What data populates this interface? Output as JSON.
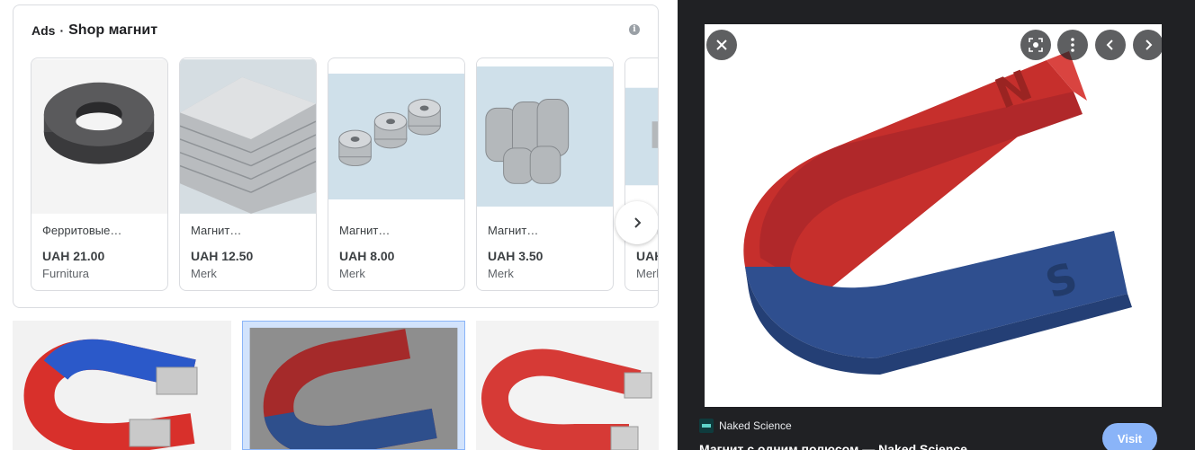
{
  "ads": {
    "label": "Ads",
    "separator": "·",
    "title": "Shop магнит",
    "info_icon": "i"
  },
  "products": [
    {
      "name": "Ферритовые…",
      "price": "UAH 21.00",
      "merchant": "Furnitura",
      "image": "ferrite-ring-magnet"
    },
    {
      "name": "Магнит…",
      "price": "UAH 12.50",
      "merchant": "Merk",
      "image": "block-magnets-stack"
    },
    {
      "name": "Магнит…",
      "price": "UAH 8.00",
      "merchant": "Merk",
      "image": "countersunk-ring-magnets"
    },
    {
      "name": "Магнит…",
      "price": "UAH 3.50",
      "merchant": "Merk",
      "image": "disc-magnets-stack"
    },
    {
      "name": "Магнит…",
      "price": "UAH",
      "merchant": "Merk",
      "image": "partial-magnet"
    }
  ],
  "carousel": {
    "next_icon": "chevron-right-icon"
  },
  "results": [
    {
      "image": "horseshoe-magnet-red-blue"
    },
    {
      "image": "horseshoe-magnet-n-s",
      "selected": true
    },
    {
      "image": "horseshoe-magnet-red"
    }
  ],
  "preview": {
    "source_name": "Naked Science",
    "title": "Магнит с одним полюсом — Naked Science",
    "visit_label": "Visit",
    "pole_north": "N",
    "pole_south": "S",
    "icons": [
      "close-icon",
      "lens-icon",
      "more-icon",
      "prev-icon",
      "next-icon"
    ]
  },
  "colors": {
    "magnet_red": "#c62f2c",
    "magnet_blue": "#2f4f8f",
    "visit_button": "#8ab4f8",
    "preview_bg": "#202124"
  }
}
